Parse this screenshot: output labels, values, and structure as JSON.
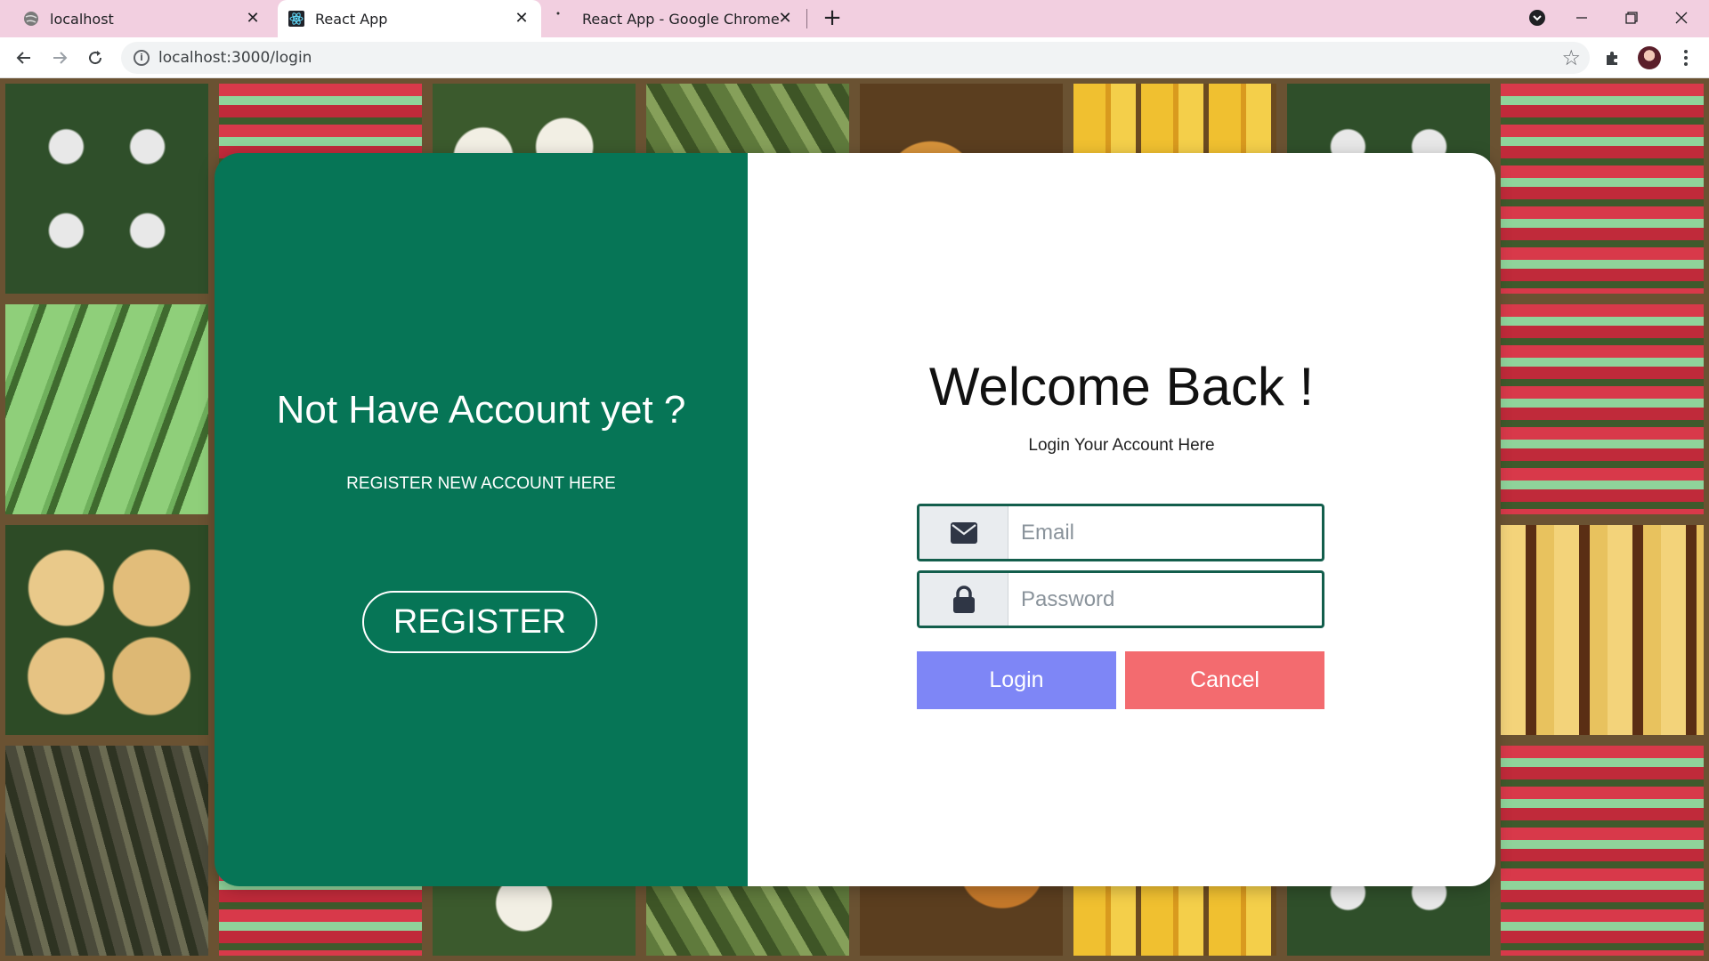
{
  "browser": {
    "tabs": [
      {
        "title": "localhost",
        "active": false
      },
      {
        "title": "React App",
        "active": true
      },
      {
        "title": "React App - Google Chrome",
        "active": false
      }
    ],
    "url": "localhost:3000/login"
  },
  "colors": {
    "left_panel": "#067556",
    "login_button": "#7e86f6",
    "cancel_button": "#f36b6f",
    "input_border": "#135e4c",
    "tab_strip": "#f2cfe0"
  },
  "register_panel": {
    "title": "Not Have Account yet ?",
    "subtitle": "REGISTER NEW ACCOUNT HERE",
    "button_label": "REGISTER"
  },
  "login_panel": {
    "title": "Welcome Back !",
    "subtitle": "Login Your Account Here",
    "email": {
      "placeholder": "Email",
      "value": "",
      "icon": "envelope-icon"
    },
    "password": {
      "placeholder": "Password",
      "value": "",
      "icon": "lock-icon"
    },
    "login_label": "Login",
    "cancel_label": "Cancel"
  }
}
